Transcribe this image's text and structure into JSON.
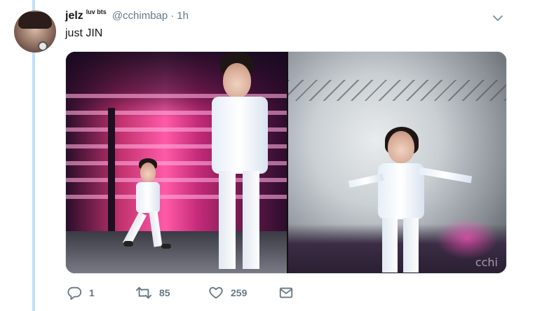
{
  "tweet": {
    "display_name": "jelz",
    "name_superscript": "luv bts",
    "handle": "@cchimbap",
    "separator": "·",
    "timestamp": "1h",
    "text": "just JIN"
  },
  "media": {
    "watermark": "cchi"
  },
  "actions": {
    "reply_count": "1",
    "retweet_count": "85",
    "like_count": "259"
  },
  "icons": {
    "reply": "reply-icon",
    "retweet": "retweet-icon",
    "like": "heart-icon",
    "dm": "envelope-icon",
    "caret": "chevron-down-icon"
  },
  "colors": {
    "thread_line": "#bfe1f6",
    "secondary_text": "#657786",
    "primary_text": "#14171a"
  }
}
